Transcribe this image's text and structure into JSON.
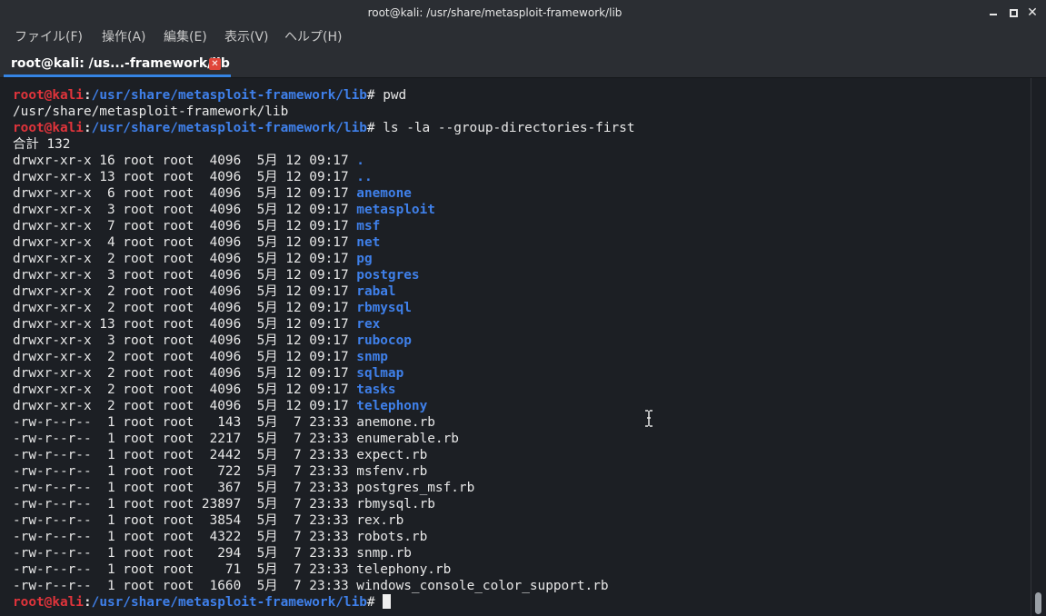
{
  "window": {
    "title": "root@kali: /usr/share/metasploit-framework/lib",
    "close_glyph": "✕"
  },
  "menu": [
    {
      "label": "ファイル(F)"
    },
    {
      "label": "操作(A)"
    },
    {
      "label": "編集(E)"
    },
    {
      "label": "表示(V)"
    },
    {
      "label": "ヘルプ(H)"
    }
  ],
  "tab": {
    "label": "root@kali: /us...-framework/lib",
    "close_glyph": "✕"
  },
  "prompt": {
    "user": "root@kali",
    "colon": ":",
    "path": "/usr/share/metasploit-framework/lib",
    "symbol": "# "
  },
  "terminal": {
    "cmd1": "pwd",
    "out1": "/usr/share/metasploit-framework/lib",
    "cmd2": "ls -la --group-directories-first",
    "total": "合計 132",
    "entries": [
      {
        "meta": "drwxr-xr-x 16 root root  4096  5月 12 09:17 ",
        "name": ".",
        "dir": true
      },
      {
        "meta": "drwxr-xr-x 13 root root  4096  5月 12 09:17 ",
        "name": "..",
        "dir": true
      },
      {
        "meta": "drwxr-xr-x  6 root root  4096  5月 12 09:17 ",
        "name": "anemone",
        "dir": true
      },
      {
        "meta": "drwxr-xr-x  3 root root  4096  5月 12 09:17 ",
        "name": "metasploit",
        "dir": true
      },
      {
        "meta": "drwxr-xr-x  7 root root  4096  5月 12 09:17 ",
        "name": "msf",
        "dir": true
      },
      {
        "meta": "drwxr-xr-x  4 root root  4096  5月 12 09:17 ",
        "name": "net",
        "dir": true
      },
      {
        "meta": "drwxr-xr-x  2 root root  4096  5月 12 09:17 ",
        "name": "pg",
        "dir": true
      },
      {
        "meta": "drwxr-xr-x  3 root root  4096  5月 12 09:17 ",
        "name": "postgres",
        "dir": true
      },
      {
        "meta": "drwxr-xr-x  2 root root  4096  5月 12 09:17 ",
        "name": "rabal",
        "dir": true
      },
      {
        "meta": "drwxr-xr-x  2 root root  4096  5月 12 09:17 ",
        "name": "rbmysql",
        "dir": true
      },
      {
        "meta": "drwxr-xr-x 13 root root  4096  5月 12 09:17 ",
        "name": "rex",
        "dir": true
      },
      {
        "meta": "drwxr-xr-x  3 root root  4096  5月 12 09:17 ",
        "name": "rubocop",
        "dir": true
      },
      {
        "meta": "drwxr-xr-x  2 root root  4096  5月 12 09:17 ",
        "name": "snmp",
        "dir": true
      },
      {
        "meta": "drwxr-xr-x  2 root root  4096  5月 12 09:17 ",
        "name": "sqlmap",
        "dir": true
      },
      {
        "meta": "drwxr-xr-x  2 root root  4096  5月 12 09:17 ",
        "name": "tasks",
        "dir": true
      },
      {
        "meta": "drwxr-xr-x  2 root root  4096  5月 12 09:17 ",
        "name": "telephony",
        "dir": true
      },
      {
        "meta": "-rw-r--r--  1 root root   143  5月  7 23:33 ",
        "name": "anemone.rb",
        "dir": false
      },
      {
        "meta": "-rw-r--r--  1 root root  2217  5月  7 23:33 ",
        "name": "enumerable.rb",
        "dir": false
      },
      {
        "meta": "-rw-r--r--  1 root root  2442  5月  7 23:33 ",
        "name": "expect.rb",
        "dir": false
      },
      {
        "meta": "-rw-r--r--  1 root root   722  5月  7 23:33 ",
        "name": "msfenv.rb",
        "dir": false
      },
      {
        "meta": "-rw-r--r--  1 root root   367  5月  7 23:33 ",
        "name": "postgres_msf.rb",
        "dir": false
      },
      {
        "meta": "-rw-r--r--  1 root root 23897  5月  7 23:33 ",
        "name": "rbmysql.rb",
        "dir": false
      },
      {
        "meta": "-rw-r--r--  1 root root  3854  5月  7 23:33 ",
        "name": "rex.rb",
        "dir": false
      },
      {
        "meta": "-rw-r--r--  1 root root  4322  5月  7 23:33 ",
        "name": "robots.rb",
        "dir": false
      },
      {
        "meta": "-rw-r--r--  1 root root   294  5月  7 23:33 ",
        "name": "snmp.rb",
        "dir": false
      },
      {
        "meta": "-rw-r--r--  1 root root    71  5月  7 23:33 ",
        "name": "telephony.rb",
        "dir": false
      },
      {
        "meta": "-rw-r--r--  1 root root  1660  5月  7 23:33 ",
        "name": "windows_console_color_support.rb",
        "dir": false
      }
    ]
  },
  "colors": {
    "background": "#1c1f24",
    "chrome": "#2b2e33",
    "prompt_user": "#e0343b",
    "prompt_path": "#3f80ea",
    "directory": "#3f80ea",
    "text": "#e8e8e8",
    "tab_accent": "#3584e4",
    "tab_close": "#e0463a"
  },
  "icons": {
    "minimize": "minimize-icon",
    "maximize": "maximize-icon",
    "close": "close-icon",
    "text_cursor": "i-beam-cursor-icon"
  }
}
